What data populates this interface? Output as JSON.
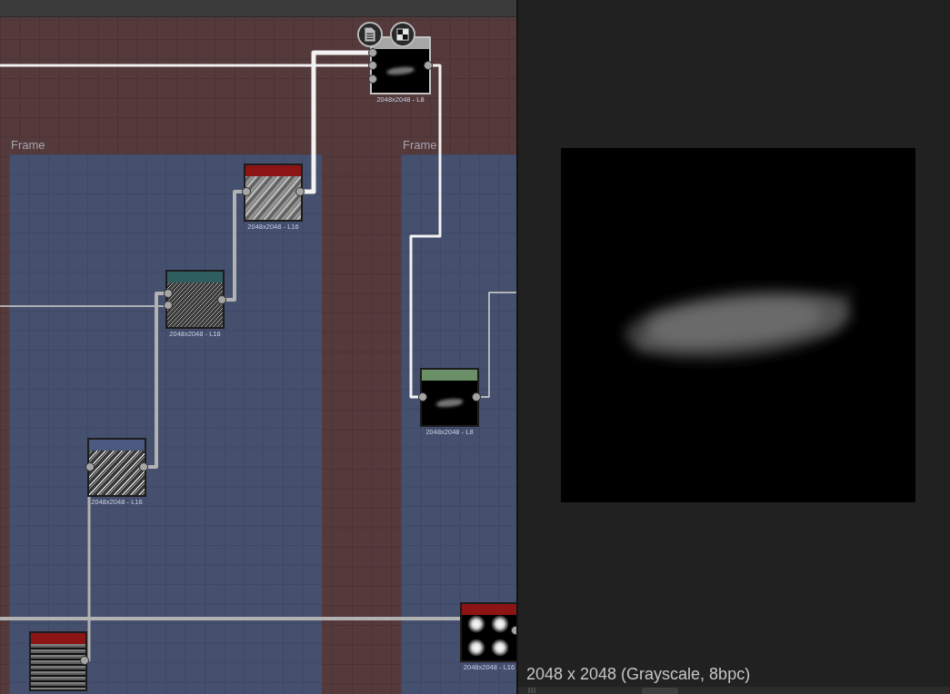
{
  "graph": {
    "frames": [
      {
        "title": "Frame"
      },
      {
        "title": "Frame"
      }
    ],
    "nodes": [
      {
        "kind": "blur",
        "color": "#a6a6a6",
        "selected": true,
        "resolution": "2048x2048 - L8"
      },
      {
        "kind": "streaks",
        "color": "#8c1414",
        "selected": false,
        "resolution": "2048x2048 - L16"
      },
      {
        "kind": "dense-lines",
        "color": "#2f5e60",
        "selected": false,
        "resolution": "2048x2048 - L16"
      },
      {
        "kind": "blur",
        "color": "#6b8f66",
        "selected": false,
        "resolution": "2048x2048 - L8"
      },
      {
        "kind": "diagonal-lines",
        "color": "#4a5980",
        "selected": false,
        "resolution": "2048x2048 - L16"
      },
      {
        "kind": "spots",
        "color": "#8c1414",
        "selected": false,
        "resolution": "2048x2048 - L16"
      },
      {
        "kind": "horizontal-lines",
        "color": "#8c1414",
        "selected": false
      }
    ]
  },
  "preview": {
    "info": "2048 x 2048 (Grayscale, 8bpc)"
  }
}
